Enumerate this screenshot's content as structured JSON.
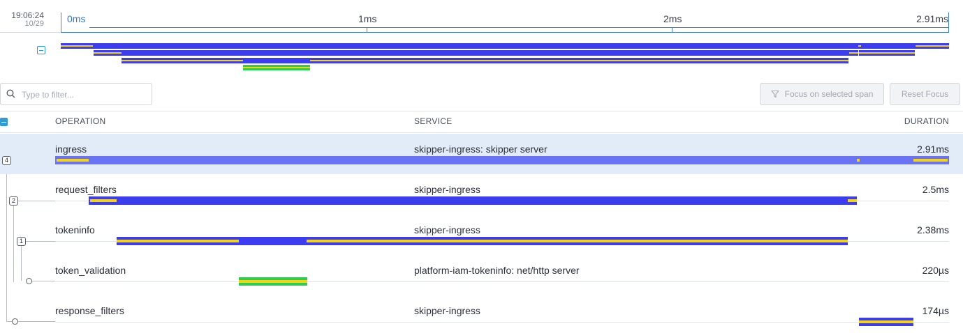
{
  "header": {
    "time": "19:06:24",
    "date": "10/29"
  },
  "axis": {
    "start_label": "0ms",
    "labels": [
      "1ms",
      "2ms",
      "2.91ms"
    ]
  },
  "filter": {
    "placeholder": "Type to filter..."
  },
  "buttons": {
    "focus_label": "Focus on selected span",
    "reset_label": "Reset Focus"
  },
  "table": {
    "headers": {
      "operation": "OPERATION",
      "service": "SERVICE",
      "duration": "DURATION"
    },
    "rows": [
      {
        "operation": "ingress",
        "service": "skipper-ingress: skipper server",
        "duration": "2.91ms",
        "children": "4"
      },
      {
        "operation": "request_filters",
        "service": "skipper-ingress",
        "duration": "2.5ms",
        "children": "2"
      },
      {
        "operation": "tokeninfo",
        "service": "skipper-ingress",
        "duration": "2.38ms",
        "children": "1"
      },
      {
        "operation": "token_validation",
        "service": "platform-iam-tokeninfo: net/http server",
        "duration": "220µs"
      },
      {
        "operation": "response_filters",
        "service": "skipper-ingress",
        "duration": "174µs"
      }
    ]
  },
  "colors": {
    "span_blue": "#3d3df0",
    "span_blue_selected": "#6b73f5",
    "span_yellow": "#f5d40f",
    "span_green": "#2ecc55",
    "accent": "#2f9bd7"
  }
}
